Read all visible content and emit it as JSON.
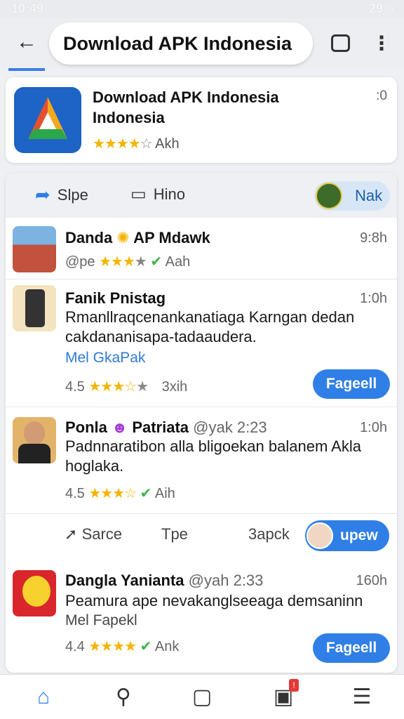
{
  "status": {
    "time": "10:49",
    "battery": "29%"
  },
  "topbar": {
    "url_text": "Download APK Indonesia"
  },
  "app": {
    "title_line1": "Download APK Indonesia",
    "title_line2": "Indonesia",
    "meta": ":0",
    "rating_label": "Akh",
    "rating_stars": 3.5
  },
  "actions": {
    "share_label": "Slpe",
    "media_label": "Hino",
    "chip_label": "Nak"
  },
  "posts": [
    {
      "name": "Danda",
      "name2": "AP Mdawk",
      "time": "9:8h",
      "prefix": "@pe",
      "rating_label": "Aah"
    },
    {
      "name": "Fanik Pnistag",
      "time": "1:0h",
      "text": "Rmanllraqcenankanatiaga Karngan dedan cakdananisapa-tadaaudera.",
      "link": "Mel GkaPak",
      "rating": "4.5",
      "rating_label": "3xih",
      "button": "Fageell"
    },
    {
      "name": "Ponla",
      "name2": "Patriata",
      "handle": "@yak 2:23",
      "time": "1:0h",
      "text": "Padnnaratibon alla bligoekan balanem Akla hoglaka.",
      "rating": "4.5",
      "rating_label": "Aih"
    },
    {
      "name": "Dangla Yanianta",
      "handle": "@yah 2:33",
      "time": "160h",
      "text": "Peamura ape nevakanglseeaga demsaninn",
      "link": "Mel Fapekl",
      "rating": "4.4",
      "rating_label": "Ank",
      "button": "Fageell"
    }
  ],
  "post_actions": {
    "a1": "Sarce",
    "a2": "Tpe",
    "a3": "3apck",
    "btn": "upew"
  },
  "colors": {
    "accent": "#2f7fe6",
    "star": "#f5b400"
  }
}
